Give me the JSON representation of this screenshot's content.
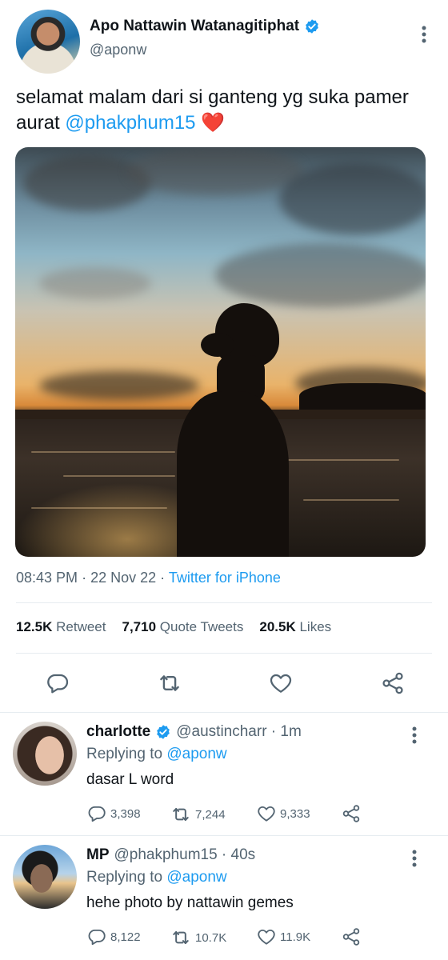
{
  "tweet": {
    "author_name": "Apo Nattawin Watanagitiphat",
    "author_handle": "@aponw",
    "text_main": "selamat malam dari si ganteng yg suka pamer aurat ",
    "text_mention": "@phakphum15",
    "text_emoji": "❤️",
    "time": "08:43 PM",
    "date": "22 Nov 22",
    "separator": "·",
    "source": "Twitter for iPhone",
    "photo_icon": "sunset-silhouette-photo"
  },
  "stats": {
    "retweets_count": "12.5K",
    "retweets_label": "Retweet",
    "quotes_count": "7,710",
    "quotes_label": "Quote Tweets",
    "likes_count": "20.5K",
    "likes_label": "Likes"
  },
  "actions": [
    "reply-icon",
    "retweet-icon",
    "like-icon",
    "share-icon"
  ],
  "replies": [
    {
      "name": "charlotte",
      "verified": true,
      "handle_time": "@austincharr · 1m",
      "replying_prefix": "Replying to",
      "replying_to": "@aponw",
      "text": "dasar L word",
      "replies": "3,398",
      "retweets": "7,244",
      "likes": "9,333"
    },
    {
      "name": "MP",
      "verified": false,
      "handle_time": "@phakphum15 · 40s",
      "replying_prefix": "Replying to",
      "replying_to": "@aponw",
      "text": "hehe photo by nattawin gemes",
      "replies": "8,122",
      "retweets": "10.7K",
      "likes": "11.9K"
    }
  ],
  "colors": {
    "accent": "#1d9bf0",
    "text": "#0f1419",
    "secondary": "#536471",
    "heart": "#e0245e",
    "divider": "#e6ecf0"
  }
}
